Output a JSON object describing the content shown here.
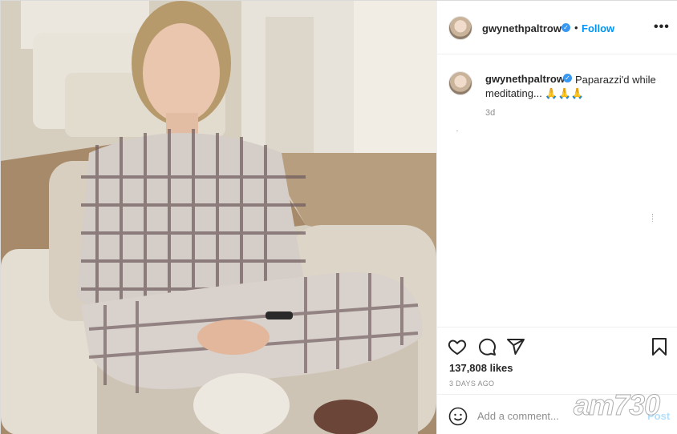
{
  "post": {
    "image_alt": "Woman in plaid pajamas meditating cross-legged on a white sofa",
    "header": {
      "username": "gwynethpaltrow",
      "separator": "•",
      "follow_label": "Follow",
      "more_label": "•••"
    },
    "caption": {
      "username": "gwynethpaltrow",
      "text": "Paparazzi'd while meditating... 🙏🙏🙏",
      "time": "3d"
    },
    "actions": {
      "icons": [
        "heart-icon",
        "comment-icon",
        "share-icon",
        "bookmark-icon"
      ],
      "likes": "137,808 likes",
      "date": "3 DAYS AGO"
    },
    "comment": {
      "placeholder": "Add a comment...",
      "post_label": "Post"
    },
    "watermark": "am730"
  },
  "colors": {
    "accent": "#0095f6",
    "verified": "#3897f0",
    "post_disabled": "#b2dffc",
    "muted": "#8e8e8e"
  }
}
